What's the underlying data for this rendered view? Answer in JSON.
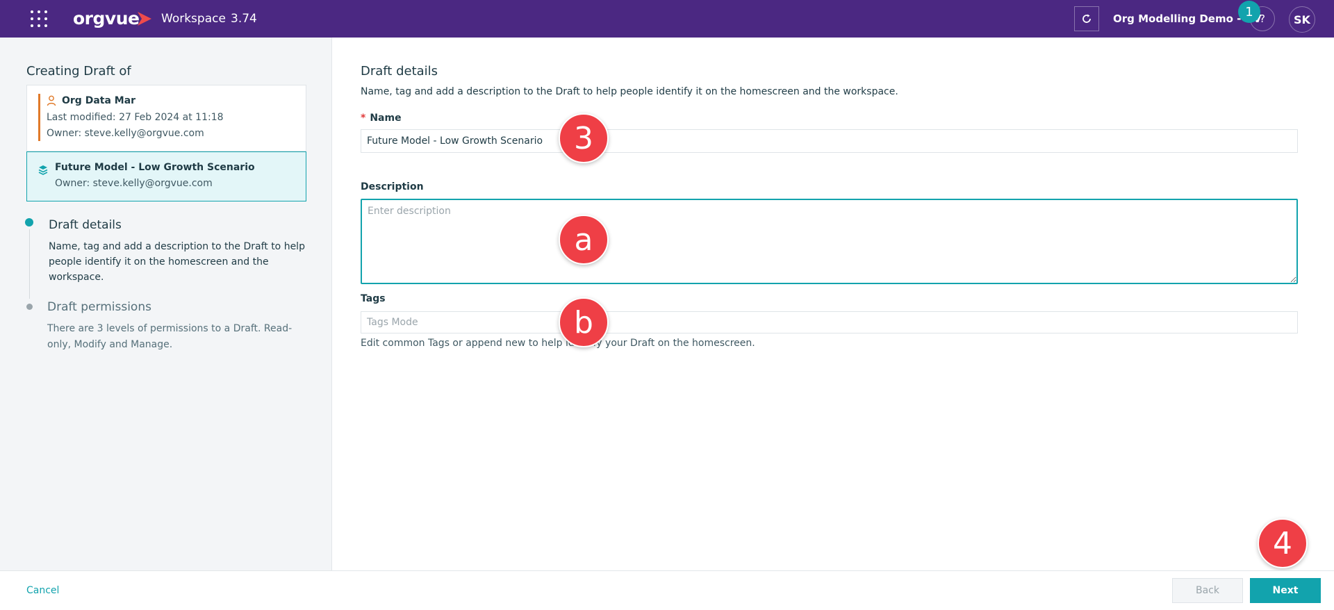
{
  "header": {
    "brand": "orgvue",
    "workspace_label": "Workspace",
    "version": "3.74",
    "org_name": "Org Modelling Demo - OV",
    "help_label": "?",
    "avatar_initials": "SK",
    "colors": {
      "bar": "#4b2882",
      "accent": "#12a3ad",
      "brand_mark": "#ef4b4b"
    }
  },
  "sidebar": {
    "title": "Creating Draft of",
    "source": {
      "name": "Org Data Mar",
      "last_modified": "Last modified: 27 Feb 2024 at 11:18",
      "owner": "Owner: steve.kelly@orgvue.com"
    },
    "draft": {
      "name": "Future Model - Low Growth Scenario",
      "owner": "Owner: steve.kelly@orgvue.com"
    },
    "steps": [
      {
        "title": "Draft details",
        "description": "Name, tag and add a description to the Draft to help people identify it on the homescreen and the workspace."
      },
      {
        "title": "Draft permissions",
        "description": "There are 3 levels of permissions to a Draft. Read-only, Modify and Manage."
      }
    ]
  },
  "form": {
    "title": "Draft details",
    "subtitle": "Name, tag and add a description to the Draft to help people identify it on the homescreen and the workspace.",
    "name_label": "Name",
    "required_mark": "*",
    "name_value": "Future Model - Low Growth Scenario",
    "description_label": "Description",
    "description_placeholder": "Enter description",
    "tags_label": "Tags",
    "tags_placeholder": "Tags Mode",
    "tags_help": "Edit common Tags or append new to help identify your Draft on the homescreen."
  },
  "callouts": {
    "top": "1",
    "name": "3",
    "description": "a",
    "tags": "b",
    "next": "4"
  },
  "footer": {
    "cancel": "Cancel",
    "back": "Back",
    "next": "Next"
  }
}
